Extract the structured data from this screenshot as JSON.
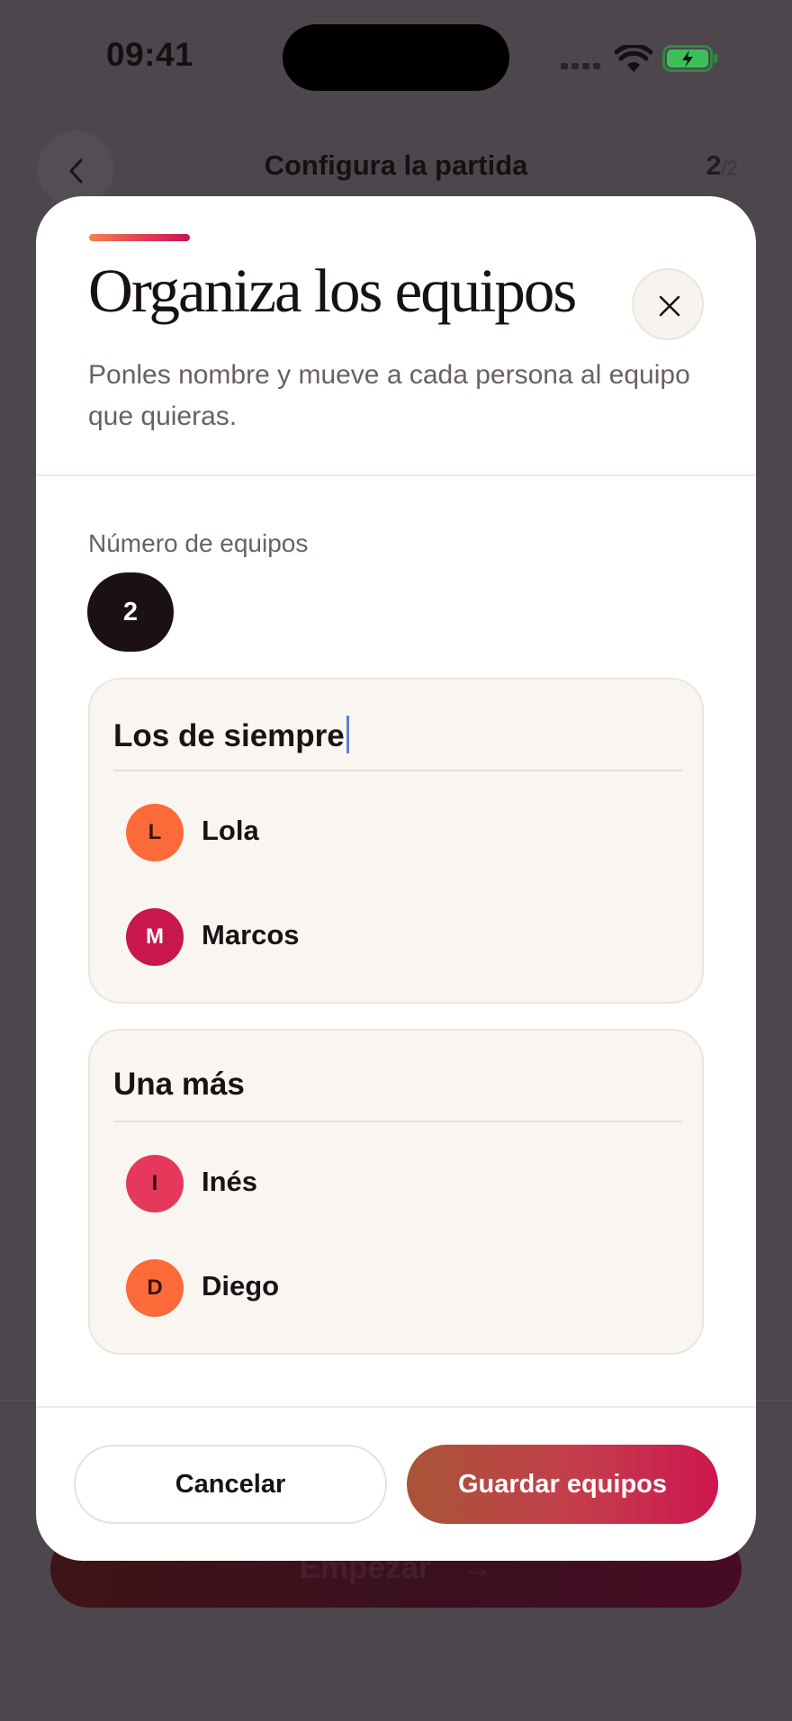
{
  "status_bar": {
    "time": "09:41"
  },
  "background": {
    "title": "Configura la partida",
    "step_current": "2",
    "step_total": "/2",
    "start_label": "Empezar",
    "start_arrow": "→"
  },
  "modal": {
    "title": "Organiza los equipos",
    "subtitle": "Ponles nombre y mueve a cada persona al equipo que quieras.",
    "team_count_label": "Número de equipos",
    "team_count": "2",
    "teams": [
      {
        "name": "Los de siempre",
        "editing": true,
        "members": [
          {
            "initial": "L",
            "name": "Lola",
            "color": "#fd6a3a"
          },
          {
            "initial": "M",
            "name": "Marcos",
            "color": "#c8174e"
          }
        ]
      },
      {
        "name": "Una más",
        "editing": false,
        "members": [
          {
            "initial": "I",
            "name": "Inés",
            "color": "#e5385a"
          },
          {
            "initial": "D",
            "name": "Diego",
            "color": "#fd6a3a"
          }
        ]
      }
    ],
    "cancel_label": "Cancelar",
    "save_label": "Guardar equipos"
  },
  "icons": {
    "back": "chevron-left-icon",
    "close": "close-icon",
    "signal": "signal-icon",
    "wifi": "wifi-icon",
    "battery": "battery-charging-icon"
  },
  "colors": {
    "accent_start": "#f4824a",
    "accent_end": "#cd174f",
    "dark_chip": "#1c1112",
    "caret": "#5c7fd0",
    "battery_green": "#3cc15a"
  }
}
